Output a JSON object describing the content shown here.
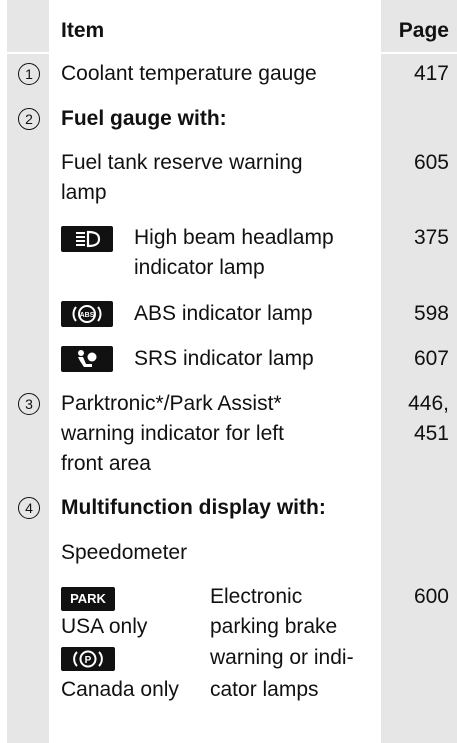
{
  "header": {
    "item": "Item",
    "page": "Page"
  },
  "rows": [
    {
      "num": "1",
      "item": "Coolant temperature gauge",
      "page": "417"
    },
    {
      "num": "2",
      "item": "Fuel gauge with:"
    },
    {
      "item": [
        "Fuel tank reserve warning",
        "lamp"
      ],
      "page": "605"
    },
    {
      "icon": "high-beam-icon",
      "item": [
        "High beam headlamp",
        "indicator lamp"
      ],
      "page": "375"
    },
    {
      "icon": "abs-icon",
      "item": "ABS indicator lamp",
      "page": "598"
    },
    {
      "icon": "srs-icon",
      "item": "SRS indicator lamp",
      "page": "607"
    },
    {
      "num": "3",
      "item": [
        "Parktronic*/Park Assist*",
        "warning indicator for left",
        "front area"
      ],
      "page": [
        "446,",
        "451"
      ]
    },
    {
      "num": "4",
      "item": "Multifunction display with:"
    },
    {
      "item": "Speedometer"
    },
    {
      "badge_park": "PARK",
      "region_usa": "USA only",
      "region_canada": "Canada only",
      "icon_canada": "parking-brake-icon",
      "item": [
        "Electronic",
        "parking brake",
        "warning or indi-",
        "cator lamps"
      ],
      "page": "600"
    }
  ]
}
